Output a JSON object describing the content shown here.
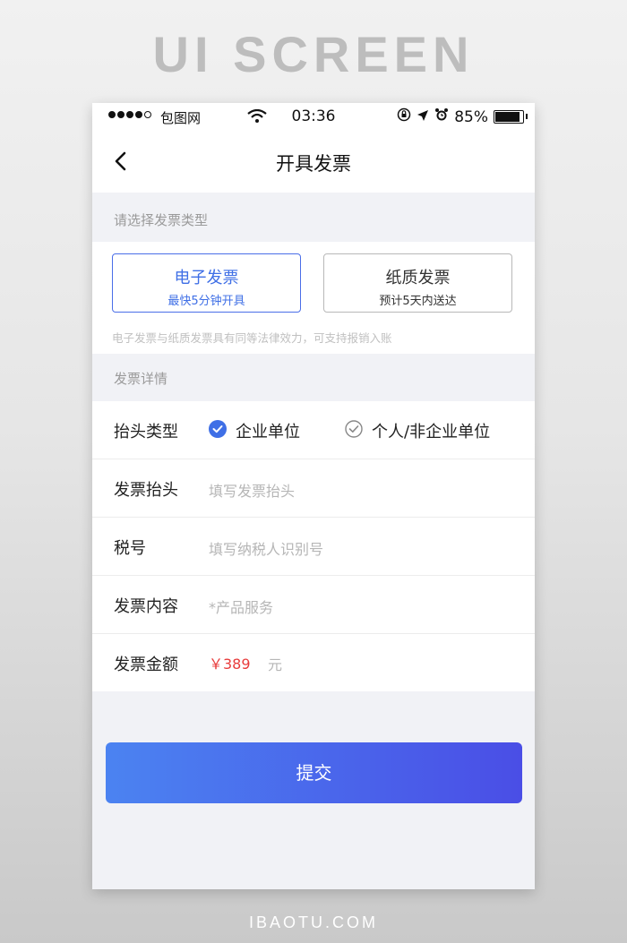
{
  "banner": "UI SCREEN",
  "footer": "IBAOTU.COM",
  "status": {
    "carrier": "包图网",
    "time": "03:36",
    "battery": "85%"
  },
  "nav": {
    "title": "开具发票"
  },
  "invoice_type": {
    "section_label": "请选择发票类型",
    "options": [
      {
        "title": "电子发票",
        "subtitle": "最快5分钟开具",
        "selected": true
      },
      {
        "title": "纸质发票",
        "subtitle": "预计5天内送达",
        "selected": false
      }
    ],
    "note": "电子发票与纸质发票具有同等法律效力，可支持报销入账"
  },
  "details": {
    "section_label": "发票详情",
    "header_type": {
      "label": "抬头类型",
      "option_company": "企业单位",
      "option_personal": "个人/非企业单位"
    },
    "invoice_title": {
      "label": "发票抬头",
      "placeholder": "填写发票抬头"
    },
    "tax_id": {
      "label": "税号",
      "placeholder": "填写纳税人识别号"
    },
    "content": {
      "label": "发票内容",
      "placeholder": "*产品服务"
    },
    "amount": {
      "label": "发票金额",
      "value": "￥389",
      "unit": "元"
    }
  },
  "submit_label": "提交",
  "colors": {
    "accent": "#3f6fe6",
    "price": "#e83c3c",
    "button_start": "#4b83f1",
    "button_end": "#4a4ee6"
  }
}
